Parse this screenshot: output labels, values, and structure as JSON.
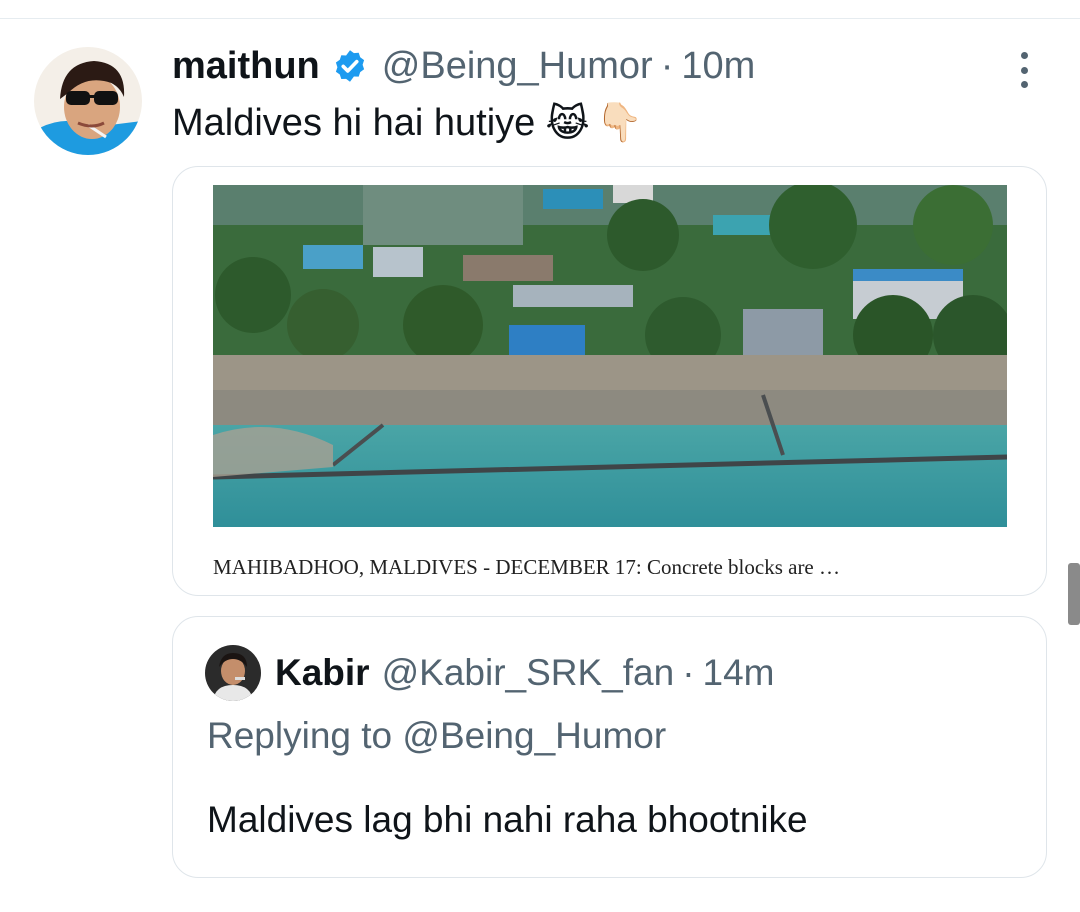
{
  "tweet": {
    "author_name": "maithun",
    "author_handle": "@Being_Humor",
    "separator": "·",
    "time": "10m",
    "text": "Maldives hi hai hutiye",
    "emoji_1": "😹",
    "emoji_2": "👇🏻"
  },
  "media": {
    "caption": "MAHIBADHOO, MALDIVES - DECEMBER 17: Concrete blocks are …"
  },
  "quote": {
    "author_name": "Kabir",
    "author_handle": "@Kabir_SRK_fan",
    "separator": "·",
    "time": "14m",
    "replying_to": "Replying to @Being_Humor",
    "text": "Maldives lag bhi nahi raha bhootnike"
  },
  "colors": {
    "verified_blue": "#1d9bf0",
    "secondary_text": "#536471",
    "primary_text": "#0f1419",
    "border": "#dfe5ea"
  },
  "icons": [
    "verified-badge-icon",
    "more-options-icon"
  ]
}
